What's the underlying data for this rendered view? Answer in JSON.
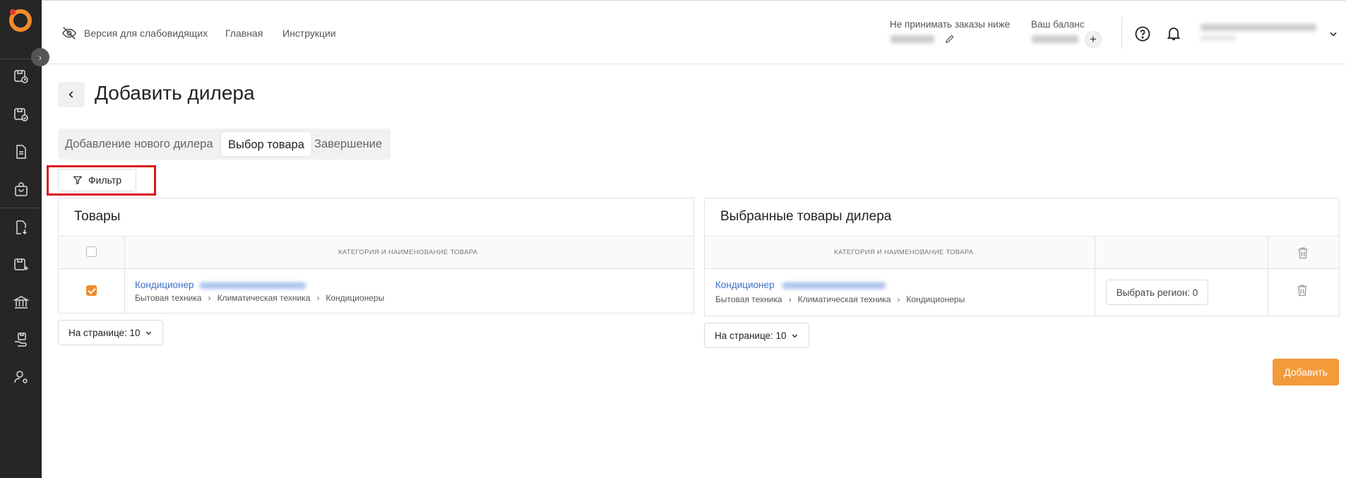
{
  "header": {
    "accessibility_label": "Версия для слабовидящих",
    "nav": [
      "Главная",
      "Инструкции"
    ],
    "min_order_label": "Не принимать заказы ниже",
    "balance_label": "Ваш баланс",
    "balance_add": "+"
  },
  "page": {
    "title": "Добавить дилера"
  },
  "tabs": [
    {
      "label": "Добавление нового дилера",
      "active": false
    },
    {
      "label": "Выбор товара",
      "active": true
    },
    {
      "label": "Завершение",
      "active": false
    }
  ],
  "filter_button": "Фильтр",
  "products_panel": {
    "title": "Товары",
    "column_header": "КАТЕГОРИЯ И НАИМЕНОВАНИЕ ТОВАРА",
    "rows": [
      {
        "name": "Кондиционер",
        "checked": true,
        "path": [
          "Бытовая техника",
          "Климатическая техника",
          "Кондиционеры"
        ]
      }
    ],
    "per_page": "На странице: 10"
  },
  "selected_panel": {
    "title": "Выбранные товары дилера",
    "column_header": "КАТЕГОРИЯ И НАИМЕНОВАНИЕ ТОВАРА",
    "rows": [
      {
        "name": "Кондиционер",
        "path": [
          "Бытовая техника",
          "Климатическая техника",
          "Кондиционеры"
        ],
        "region_button": "Выбрать регион: 0"
      }
    ],
    "per_page": "На странице: 10"
  },
  "add_button": "Добавить",
  "colors": {
    "accent": "#f39a3a",
    "link": "#3b6fc7",
    "sidebar": "#262626",
    "highlight": "#d9161b"
  }
}
